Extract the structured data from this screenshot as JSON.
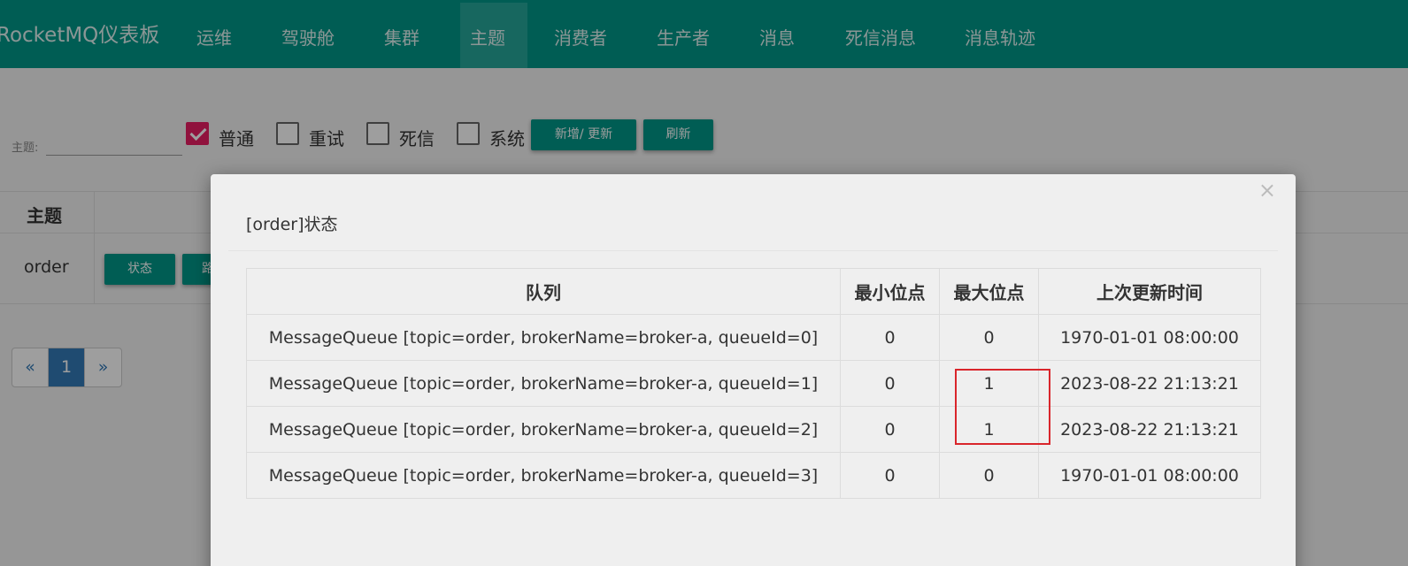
{
  "navbar": {
    "brand": "RocketMQ仪表板",
    "items": [
      "运维",
      "驾驶舱",
      "集群",
      "主题",
      "消费者",
      "生产者",
      "消息",
      "死信消息",
      "消息轨迹"
    ],
    "active": "主题"
  },
  "filter": {
    "topic_label": "主题:",
    "topic_value": "",
    "checkboxes": [
      {
        "label": "普通",
        "checked": true
      },
      {
        "label": "重试",
        "checked": false
      },
      {
        "label": "死信",
        "checked": false
      },
      {
        "label": "系统",
        "checked": false
      }
    ],
    "add_update_label": "新增/ 更新",
    "refresh_label": "刷新"
  },
  "topic_table": {
    "header_topic": "主题",
    "rows": [
      {
        "topic": "order",
        "status_button": "状态",
        "next_button_partial": "路"
      }
    ]
  },
  "pagination": {
    "prev": "«",
    "current": "1",
    "next": "»"
  },
  "modal": {
    "title": "[order]状态",
    "close": "×",
    "columns": [
      "队列",
      "最小位点",
      "最大位点",
      "上次更新时间"
    ],
    "rows": [
      {
        "queue": "MessageQueue [topic=order, brokerName=broker-a, queueId=0]",
        "min": "0",
        "max": "0",
        "updated": "1970-01-01 08:00:00"
      },
      {
        "queue": "MessageQueue [topic=order, brokerName=broker-a, queueId=1]",
        "min": "0",
        "max": "1",
        "updated": "2023-08-22 21:13:21"
      },
      {
        "queue": "MessageQueue [topic=order, brokerName=broker-a, queueId=2]",
        "min": "0",
        "max": "1",
        "updated": "2023-08-22 21:13:21"
      },
      {
        "queue": "MessageQueue [topic=order, brokerName=broker-a, queueId=3]",
        "min": "0",
        "max": "0",
        "updated": "1970-01-01 08:00:00"
      }
    ]
  },
  "colors": {
    "primary": "#009688",
    "checkbox_checked": "#e91e63",
    "highlight": "#d9252b",
    "page_active": "#337ab7"
  }
}
